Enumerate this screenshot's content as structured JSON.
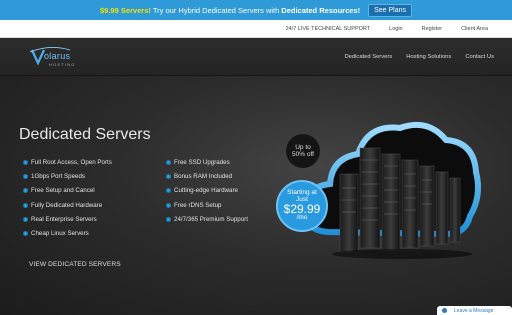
{
  "promo": {
    "highlight": "$9.99 Servers!",
    "text": "Try our Hybrid Dedicated Servers with",
    "bold": "Dedicated Resources!",
    "button": "See Plans"
  },
  "topnav": {
    "items": [
      "24/7 LIVE TECHNICAL SUPPORT",
      "Login",
      "Register",
      "Client Area"
    ]
  },
  "logo": {
    "name": "Volarus",
    "sub": "HOSTING"
  },
  "mainnav": {
    "items": [
      "Dedicated Servers",
      "Hosting Solutions",
      "Contact Us"
    ]
  },
  "hero": {
    "title": "Dedicated Servers",
    "features_left": [
      "Full Root Access, Open Ports",
      "1Gbps Port Speeds",
      "Free Setup and Cancel",
      "Fully Dedicated Hardware",
      "Real Enterprise Servers",
      "Cheap Linux Servers"
    ],
    "features_right": [
      "Free SSD Upgrades",
      "Bonus RAM Included",
      "Cutting-edge Hardware",
      "Free rDNS Setup",
      "24/7/365 Premium Support"
    ],
    "view_link": "VIEW DEDICATED SERVERS",
    "badge_off": {
      "line1": "Up to",
      "line2": "50% off"
    },
    "badge_price": {
      "line1": "Starting at",
      "line2": "Just",
      "price": "$29.99",
      "per": "/mo"
    }
  },
  "livechat": {
    "label": "Leave a Message"
  },
  "colors": {
    "accent": "#2a9ae0",
    "promo_bg": "#2f9ad8",
    "highlight": "#f6e000"
  }
}
